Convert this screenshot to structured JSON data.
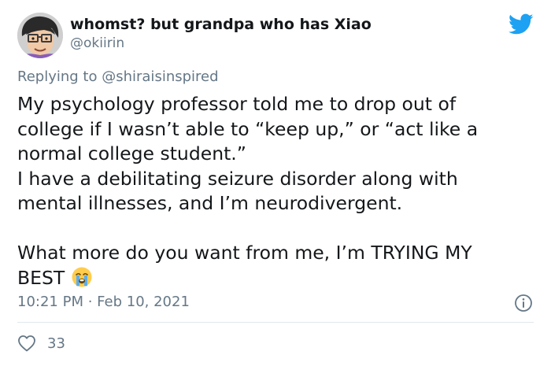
{
  "author": {
    "display_name": "whomst? but grandpa who has Xiao",
    "handle": "@okiirin",
    "avatar_icon": "cartoon-avatar-with-glasses"
  },
  "platform": {
    "icon": "twitter-bird-icon",
    "color": "#1DA1F2"
  },
  "reply": {
    "prefix": "Replying to",
    "mention": "@shiraisinspired"
  },
  "tweet": {
    "lines": [
      "My psychology professor told me to drop out of",
      "college if I wasn’t able to “keep up,” or “act like a",
      "normal college student.”",
      "I have a debilitating seizure disorder along with",
      "mental illnesses, and I’m neurodivergent.",
      "What more do you want from me, I’m TRYING MY",
      "BEST"
    ],
    "emoji": "loudly-crying-face-emoji"
  },
  "meta": {
    "timestamp": "10:21 PM · Feb 10, 2021",
    "info_icon": "info-icon"
  },
  "stats": {
    "likes": "33",
    "like_icon": "heart-icon"
  },
  "colors": {
    "text_primary": "#14171A",
    "text_secondary": "#657786",
    "divider": "#E1E8ED"
  }
}
